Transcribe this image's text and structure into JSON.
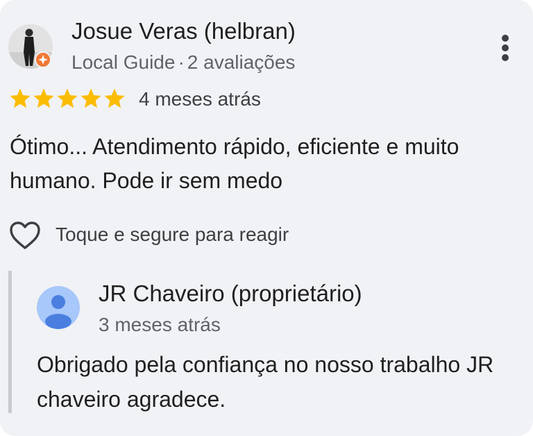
{
  "review": {
    "author_name": "Josue Veras (helbran)",
    "author_level": "Local Guide",
    "separator": "·",
    "review_count": "2 avaliações",
    "rating": 5,
    "rating_max": 5,
    "date": "4 meses atrás",
    "text": "Ótimo... Atendimento rápido, eficiente e muito humano. Pode ir sem medo",
    "react_hint": "Toque e segure para reagir"
  },
  "reply": {
    "author_name": "JR Chaveiro (proprietário)",
    "date": "3 meses atrás",
    "text": "Obrigado pela confiança no nosso trabalho JR chaveiro agradece."
  },
  "icons": {
    "more": "more-vert-icon",
    "star": "star-icon",
    "heart": "heart-outline-icon",
    "guide_badge": "local-guide-badge-icon"
  },
  "colors": {
    "card_background": "#f1f2f5",
    "star": "#fbbc04",
    "local_guide_badge": "#f07834",
    "owner_avatar": "#a8c7fa",
    "owner_avatar_figure": "#4a7fe0",
    "primary_text": "#1f1f1f",
    "secondary_text": "#5f6368"
  }
}
